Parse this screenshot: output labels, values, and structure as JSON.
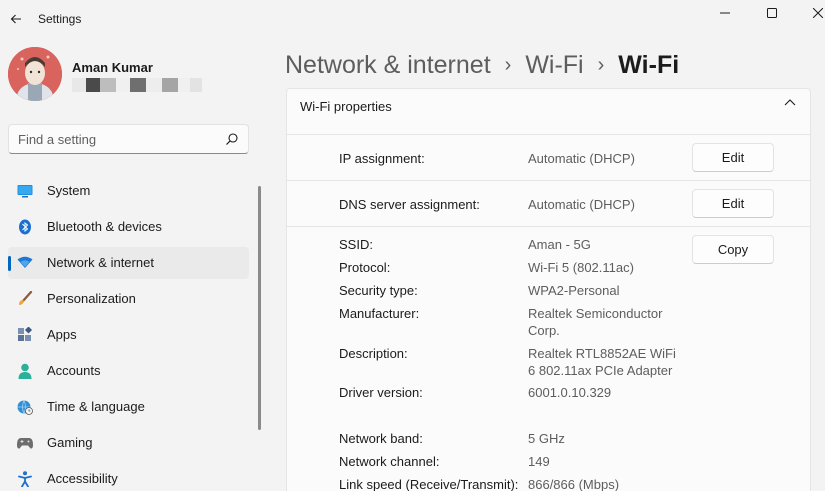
{
  "window": {
    "title": "Settings"
  },
  "profile": {
    "name": "Aman Kumar"
  },
  "search": {
    "placeholder": "Find a setting"
  },
  "nav": {
    "items": [
      {
        "label": "System",
        "icon": "monitor-icon",
        "color": "#0078d4"
      },
      {
        "label": "Bluetooth & devices",
        "icon": "bluetooth-icon",
        "color": "#0078d4"
      },
      {
        "label": "Network & internet",
        "icon": "wifi-icon",
        "color": "#0078d4",
        "active": true
      },
      {
        "label": "Personalization",
        "icon": "brush-icon",
        "color": "#e8a33d"
      },
      {
        "label": "Apps",
        "icon": "apps-icon",
        "color": "#4a6fa5"
      },
      {
        "label": "Accounts",
        "icon": "person-icon",
        "color": "#2bb09a"
      },
      {
        "label": "Time & language",
        "icon": "globe-clock-icon",
        "color": "#1e88c7"
      },
      {
        "label": "Gaming",
        "icon": "gamepad-icon",
        "color": "#6b6b6b"
      },
      {
        "label": "Accessibility",
        "icon": "accessibility-icon",
        "color": "#1e6fd0"
      }
    ]
  },
  "breadcrumb": {
    "items": [
      "Network & internet",
      "Wi-Fi",
      "Wi-Fi"
    ],
    "separator": "›"
  },
  "card": {
    "title": "Wi-Fi properties",
    "ip": {
      "label": "IP assignment:",
      "value": "Automatic (DHCP)",
      "button": "Edit"
    },
    "dns": {
      "label": "DNS server assignment:",
      "value": "Automatic (DHCP)",
      "button": "Edit"
    },
    "copy_button": "Copy",
    "properties": [
      {
        "label": "SSID:",
        "value": "Aman - 5G"
      },
      {
        "label": "Protocol:",
        "value": "Wi-Fi 5 (802.11ac)"
      },
      {
        "label": "Security type:",
        "value": "WPA2-Personal"
      },
      {
        "label": "Manufacturer:",
        "value": "Realtek Semiconductor Corp."
      },
      {
        "label": "Description:",
        "value": "Realtek RTL8852AE WiFi 6 802.11ax PCIe Adapter"
      },
      {
        "label": "Driver version:",
        "value": "6001.0.10.329"
      },
      {
        "label": "Network band:",
        "value": "5 GHz"
      },
      {
        "label": "Network channel:",
        "value": "149"
      },
      {
        "label": "Link speed (Receive/Transmit):",
        "value": "866/866 (Mbps)"
      }
    ]
  },
  "colors": {
    "accent": "#0067c0",
    "background": "#f3f3f3",
    "card": "#fbfbfb"
  }
}
